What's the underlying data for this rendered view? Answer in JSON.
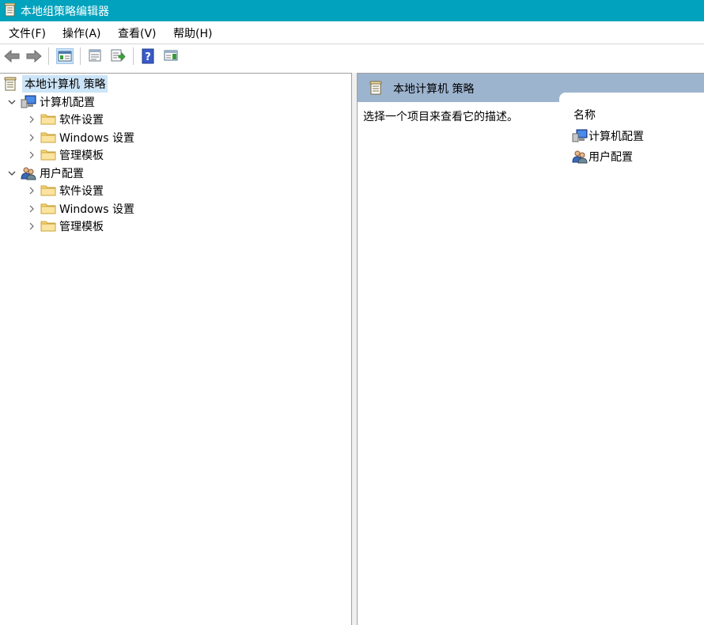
{
  "window": {
    "title": "本地组策略编辑器",
    "icon": "policy-document-icon"
  },
  "menu": {
    "items": [
      {
        "label": "文件(F)"
      },
      {
        "label": "操作(A)"
      },
      {
        "label": "查看(V)"
      },
      {
        "label": "帮助(H)"
      }
    ]
  },
  "toolbar": {
    "buttons": [
      {
        "icon": "back-arrow-icon"
      },
      {
        "icon": "forward-arrow-icon"
      },
      {
        "icon": "show-hide-tree-icon",
        "active": true
      },
      {
        "icon": "properties-icon"
      },
      {
        "icon": "export-list-icon"
      },
      {
        "icon": "help-icon"
      },
      {
        "icon": "show-hide-action-pane-icon"
      }
    ]
  },
  "tree": {
    "root": {
      "label": "本地计算机 策略",
      "icon": "policy-document-icon",
      "selected": true
    },
    "nodes": [
      {
        "label": "计算机配置",
        "icon": "computer-icon",
        "expanded": true,
        "children": [
          {
            "label": "软件设置",
            "icon": "folder-icon"
          },
          {
            "label": "Windows 设置",
            "icon": "folder-icon"
          },
          {
            "label": "管理模板",
            "icon": "folder-icon"
          }
        ]
      },
      {
        "label": "用户配置",
        "icon": "users-icon",
        "expanded": true,
        "children": [
          {
            "label": "软件设置",
            "icon": "folder-icon"
          },
          {
            "label": "Windows 设置",
            "icon": "folder-icon"
          },
          {
            "label": "管理模板",
            "icon": "folder-icon"
          }
        ]
      }
    ]
  },
  "details": {
    "header": "本地计算机 策略",
    "description": "选择一个项目来查看它的描述。",
    "column_name": "名称",
    "items": [
      {
        "label": "计算机配置",
        "icon": "computer-icon"
      },
      {
        "label": "用户配置",
        "icon": "users-icon"
      }
    ]
  },
  "colors": {
    "title_bar": "#00a2bd",
    "detail_header": "#9db4cf",
    "selection": "#cce4f7"
  }
}
